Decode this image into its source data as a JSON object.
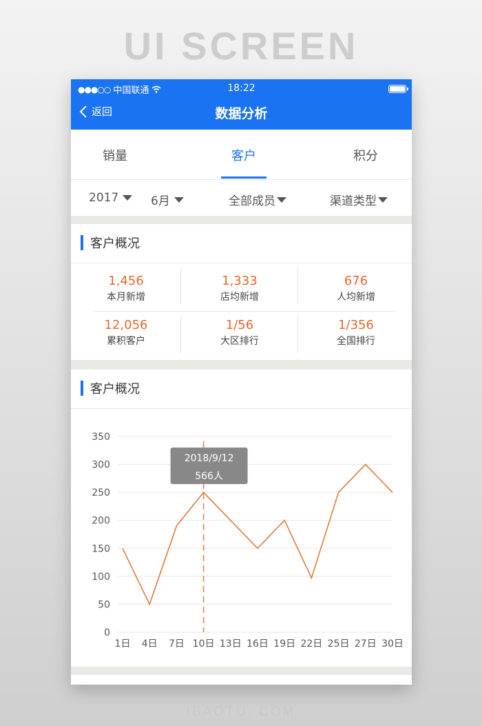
{
  "banner": "UI SCREEN",
  "footer": "IBAOTU. COM",
  "status_bar": {
    "signal": "●●●○○",
    "carrier": "中国联通",
    "time": "18:22"
  },
  "nav": {
    "back_label": "返回",
    "title": "数据分析"
  },
  "tabs": [
    {
      "label": "销量",
      "active": false
    },
    {
      "label": "客户",
      "active": true
    },
    {
      "label": "积分",
      "active": false
    }
  ],
  "filters": {
    "year": "2017",
    "month": "6月",
    "member": "全部成员",
    "channel": "渠道类型"
  },
  "overview": {
    "title": "客户概况",
    "stats": [
      {
        "value": "1,456",
        "label": "本月新增"
      },
      {
        "value": "1,333",
        "label": "店均新增"
      },
      {
        "value": "676",
        "label": "人均新增"
      },
      {
        "value": "12,056",
        "label": "累积客户"
      },
      {
        "value": "1/56",
        "label": "大区排行"
      },
      {
        "value": "1/356",
        "label": "全国排行"
      }
    ]
  },
  "trend": {
    "title": "客户概况"
  },
  "colors": {
    "accent": "#1a73f2",
    "highlight": "#e5672b",
    "line": "#e07a3c"
  },
  "chart_data": {
    "type": "line",
    "categories": [
      "1日",
      "4日",
      "7日",
      "10日",
      "13日",
      "16日",
      "19日",
      "22日",
      "25日",
      "27日",
      "30日"
    ],
    "values": [
      150,
      50,
      190,
      250,
      200,
      150,
      200,
      97,
      250,
      300,
      250
    ],
    "ylim": [
      0,
      350
    ],
    "yticks": [
      0,
      50,
      100,
      150,
      200,
      250,
      300,
      350
    ],
    "grid": true,
    "tooltip": {
      "index": 3,
      "date": "2018/9/12",
      "value": "566人"
    }
  }
}
